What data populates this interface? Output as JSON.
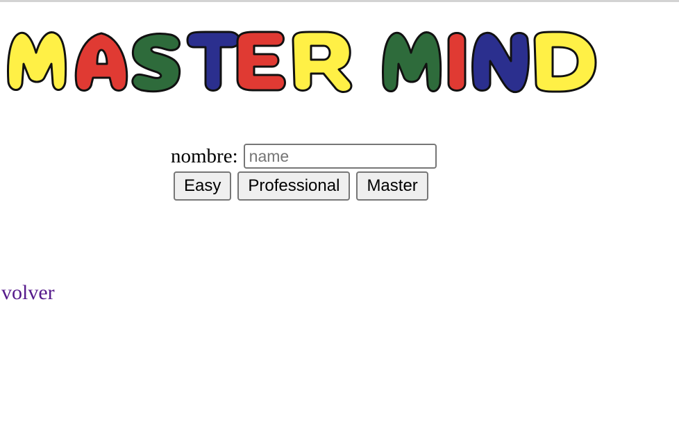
{
  "logo": {
    "text": "MASTER MIND",
    "letters": [
      {
        "char": "M",
        "color": "#fff046"
      },
      {
        "char": "A",
        "color": "#e03a33"
      },
      {
        "char": "S",
        "color": "#2e6b3b"
      },
      {
        "char": "T",
        "color": "#2b2f8e"
      },
      {
        "char": "E",
        "color": "#e03a33"
      },
      {
        "char": "R",
        "color": "#fff046"
      },
      {
        "char": "M",
        "color": "#2e6b3b"
      },
      {
        "char": "I",
        "color": "#e03a33"
      },
      {
        "char": "N",
        "color": "#2b2f8e"
      },
      {
        "char": "D",
        "color": "#fff046"
      }
    ],
    "outline_color": "#111111"
  },
  "form": {
    "name_label": "nombre:",
    "name_placeholder": "name",
    "name_value": "",
    "buttons": {
      "easy": "Easy",
      "professional": "Professional",
      "master": "Master"
    }
  },
  "back_link": {
    "label": "volver",
    "color": "#551a8b"
  }
}
